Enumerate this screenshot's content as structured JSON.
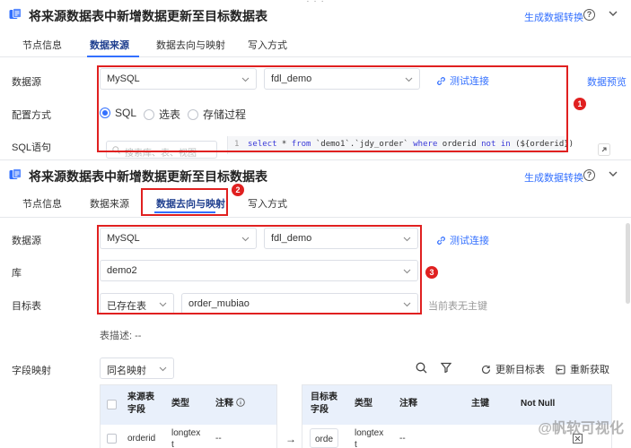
{
  "top_panel": {
    "title": "将来源数据表中新增数据更新至目标数据表",
    "generate_link": "生成数据转换",
    "help": "?",
    "tabs": [
      "节点信息",
      "数据来源",
      "数据去向与映射",
      "写入方式"
    ],
    "active_tab": 1,
    "datasource_label": "数据源",
    "datasource_value": "MySQL",
    "database_value": "fdl_demo",
    "test_connection": "测试连接",
    "data_preview": "数据预览",
    "config_label": "配置方式",
    "config_options": [
      "SQL",
      "选表",
      "存储过程"
    ],
    "config_selected": "SQL",
    "sql_label": "SQL语句",
    "search_placeholder": "搜索库、表、视图",
    "sql_line_number": "1",
    "sql_parts": {
      "select": "select",
      "star": " * ",
      "from": "from",
      "table": " `demo1`.`jdy_order` ",
      "where": "where",
      "col": " orderid ",
      "not_in": "not in",
      "param": " (${orderid})"
    },
    "badge": "1"
  },
  "bottom_panel": {
    "title": "将来源数据表中新增数据更新至目标数据表",
    "generate_link": "生成数据转换",
    "help": "?",
    "tabs": [
      "节点信息",
      "数据来源",
      "数据去向与映射",
      "写入方式"
    ],
    "active_tab": 2,
    "tab_badge": "2",
    "datasource_label": "数据源",
    "datasource_value": "MySQL",
    "database_value": "fdl_demo",
    "test_connection": "测试连接",
    "db_label": "库",
    "db_value": "demo2",
    "target_label": "目标表",
    "target_mode": "已存在表",
    "target_table": "order_mubiao",
    "no_pk_note": "当前表无主键",
    "box_badge": "3",
    "table_desc": "表描述: --",
    "field_mapping_label": "字段映射",
    "mapping_mode": "同名映射",
    "refresh_target": "更新目标表",
    "refetch": "重新获取",
    "source_table": {
      "headers": [
        "来源表\n字段",
        "类型",
        "注释"
      ],
      "rows": [
        {
          "field": "orderid",
          "type": "longtex\nt",
          "comment": "--"
        }
      ]
    },
    "target_table_grid": {
      "headers": [
        "目标表\n字段",
        "类型",
        "注释",
        "主键",
        "Not Null"
      ],
      "rows": [
        {
          "field": "orde",
          "type": "longtex\nt",
          "comment": "--"
        }
      ]
    },
    "arrow": "→",
    "watermark": "@帆软可视化"
  },
  "colors": {
    "accent": "#3370ff",
    "highlight": "#e02020",
    "table_header": "#e9f0fb"
  }
}
